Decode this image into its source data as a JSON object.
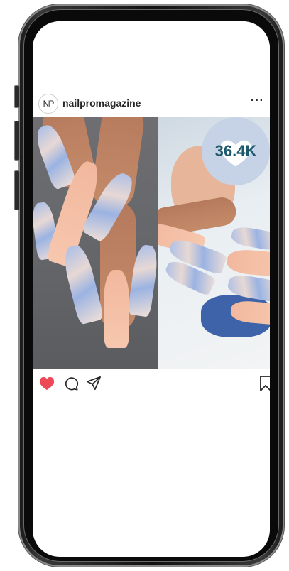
{
  "post": {
    "avatar_initials": "NP",
    "username": "nailpromagazine",
    "more_label": "···",
    "counter": "36.4K"
  },
  "actions": {
    "like_icon": "heart-filled-icon",
    "comment_icon": "comment-icon",
    "share_icon": "send-icon",
    "save_icon": "bookmark-icon",
    "like_color": "#ed4956"
  },
  "colors": {
    "counter_bg": "#c6d2e6",
    "counter_text": "#1e5a6f",
    "nail_peach": "#f4bea4",
    "nail_marble_blue": "#a8bde8"
  }
}
